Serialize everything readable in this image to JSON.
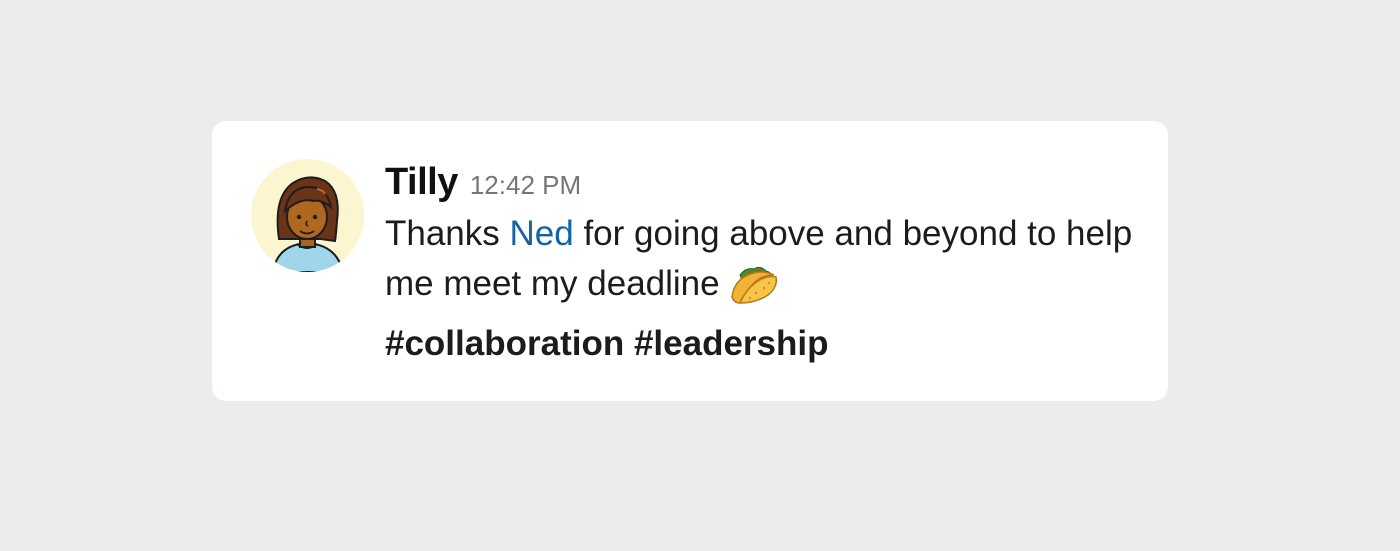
{
  "message": {
    "author": "Tilly",
    "timestamp": "12:42 PM",
    "text_before_mention": "Thanks ",
    "mention": "Ned",
    "text_after_mention": " for going above and beyond to help me meet my deadline",
    "emoji": "taco-emoji",
    "hashtags": [
      "#collaboration",
      "#leadership"
    ]
  },
  "colors": {
    "background": "#edebec",
    "card": "#ffffff",
    "mention": "#1264a3",
    "timestamp": "#767676",
    "avatar_bg": "#fbf6cf"
  }
}
